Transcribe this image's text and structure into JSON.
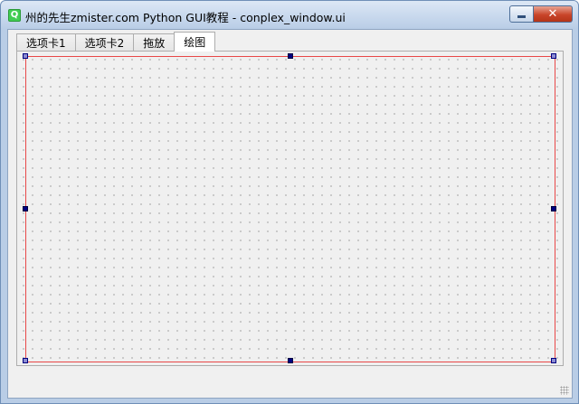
{
  "window": {
    "title": "州的先生zmister.com Python GUI教程 - conplex_window.ui",
    "icon": "qt-logo-icon",
    "controls": {
      "minimize": "minimize-icon",
      "close": "close-icon",
      "close_glyph": "✕"
    }
  },
  "tabs": [
    {
      "label": "选项卡1",
      "active": false
    },
    {
      "label": "选项卡2",
      "active": false
    },
    {
      "label": "拖放",
      "active": false
    },
    {
      "label": "绘图",
      "active": true
    }
  ],
  "colors": {
    "selection_frame": "#e84848",
    "handle": "#000080",
    "titlebar": "#c5d6ec"
  }
}
